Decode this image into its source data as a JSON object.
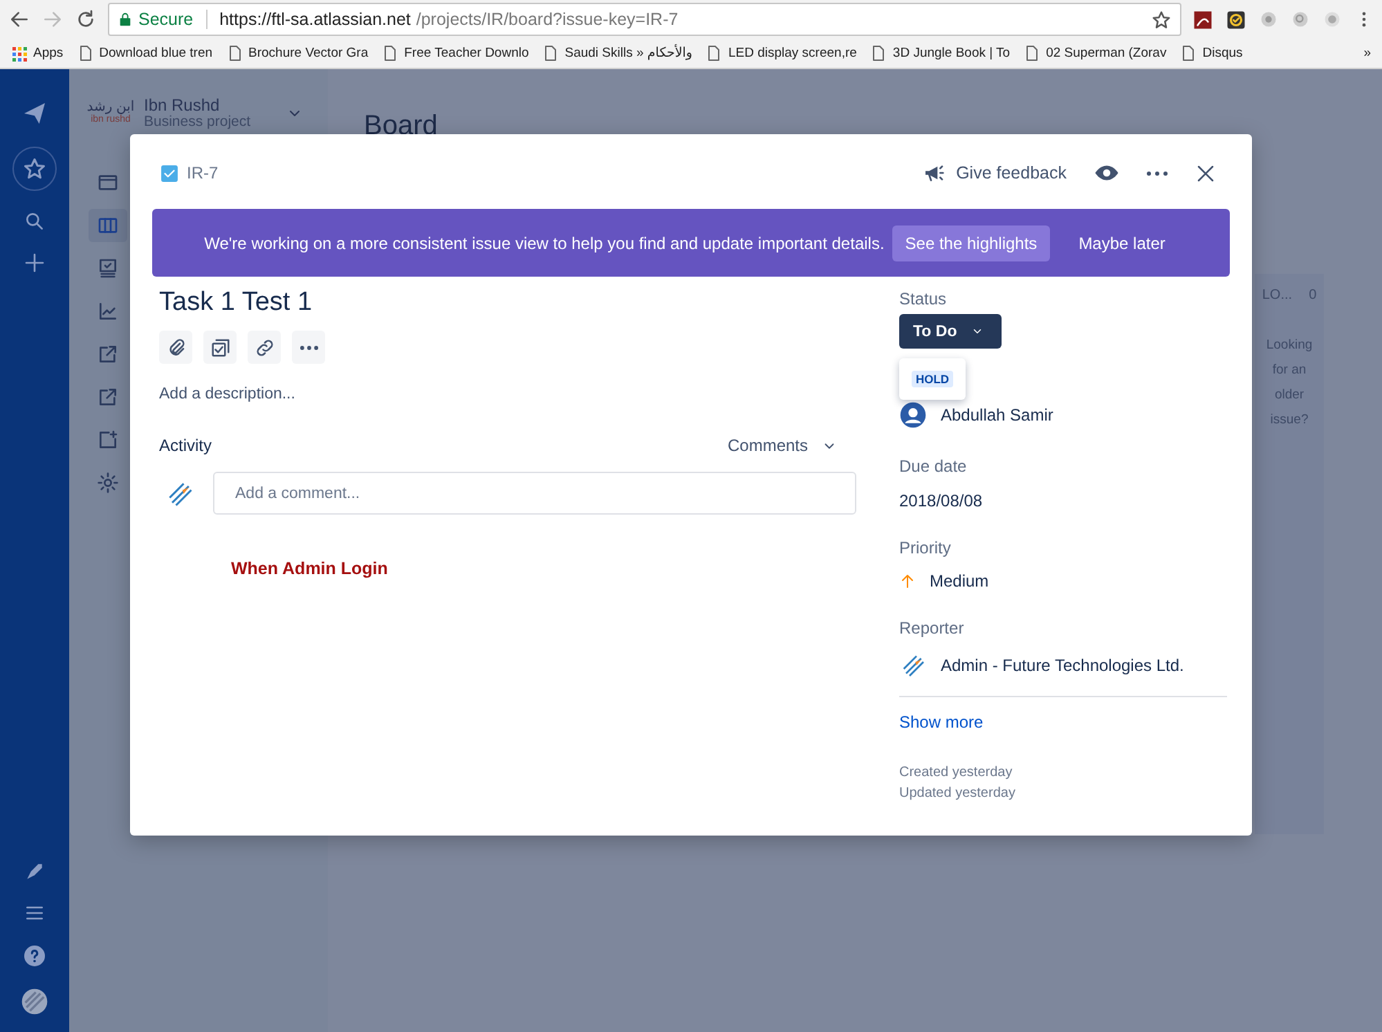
{
  "browser": {
    "secure_label": "Secure",
    "url_host": "https://ftl-sa.atlassian.net",
    "url_path": "/projects/IR/board?issue-key=IR-7",
    "apps_label": "Apps",
    "bookmarks": [
      "Download blue tren",
      "Brochure Vector Gra",
      "Free Teacher Downlo",
      "Saudi Skills » والأحكام",
      "LED display screen,re",
      "3D Jungle Book | To",
      "02 Superman (Zorav",
      "Disqus"
    ],
    "more_bookmarks": "»"
  },
  "project": {
    "logo_arabic": "ابن رشد",
    "logo_latin": "ibn rushd",
    "name": "Ibn Rushd",
    "type": "Business project",
    "nav_items": [
      {
        "kind": "window",
        "selected": false
      },
      {
        "kind": "columns",
        "selected": true
      },
      {
        "kind": "monitor",
        "selected": false
      },
      {
        "kind": "chart",
        "selected": false
      },
      {
        "kind": "external",
        "selected": false
      },
      {
        "kind": "external",
        "selected": false
      },
      {
        "kind": "add_page",
        "selected": false
      },
      {
        "kind": "gear",
        "selected": false
      }
    ]
  },
  "board": {
    "title": "Board",
    "column_title": "LO...",
    "column_count": "0",
    "older_issue_hint": "Looking for an older issue?"
  },
  "issue": {
    "key": "IR-7",
    "feedback": "Give feedback",
    "banner": {
      "text": "We're working on a more consistent issue view to help you find and update important details.",
      "primary": "See the highlights",
      "secondary": "Maybe later"
    },
    "title": "Task 1 Test 1",
    "description_placeholder": "Add a description...",
    "activity_label": "Activity",
    "activity_filter": "Comments",
    "comment_placeholder": "Add a comment...",
    "annotation": "When Admin Login",
    "status": {
      "label": "Status",
      "value": "To Do",
      "expanded": true,
      "options": [
        "HOLD"
      ]
    },
    "assignee": "Abdullah Samir",
    "due_date": {
      "label": "Due date",
      "value": "2018/08/08"
    },
    "priority": {
      "label": "Priority",
      "value": "Medium"
    },
    "reporter": {
      "label": "Reporter",
      "value": "Admin - Future Technologies Ltd."
    },
    "show_more": "Show more",
    "created": "Created yesterday",
    "updated": "Updated yesterday"
  }
}
